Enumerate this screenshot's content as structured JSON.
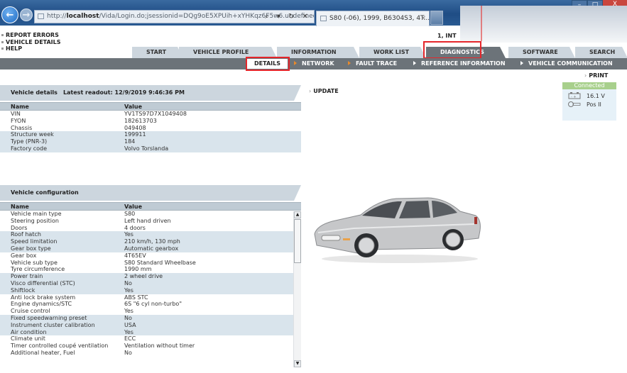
{
  "browser": {
    "url_prefix": "http://",
    "url_host": "localhost",
    "url_path": "/Vida/Login.do;jsessionid=DQg9oE5XPUih+xYHKqz6F5w6.undefined",
    "tools": "⌕ ▾ ↻ ✕",
    "tab_title": "S80 (-06), 1999, B6304S3, 4T...",
    "tab_close": "×",
    "win_min": "–",
    "win_max": "□",
    "win_close": "X"
  },
  "top_links": [
    "REPORT ERRORS",
    "VEHICLE DETAILS",
    "HELP"
  ],
  "session_label": "1, INT",
  "main_tabs": [
    {
      "label": "START",
      "active": false
    },
    {
      "label": "VEHICLE PROFILE",
      "active": false
    },
    {
      "label": "INFORMATION",
      "active": false
    },
    {
      "label": "WORK LIST",
      "active": false
    },
    {
      "label": "DIAGNOSTICS",
      "active": true
    },
    {
      "label": "SOFTWARE",
      "active": false
    },
    {
      "label": "SEARCH",
      "active": false
    }
  ],
  "sub_nav": [
    {
      "label": "DETAILS",
      "active": true
    },
    {
      "label": "NETWORK",
      "arrow": "orange"
    },
    {
      "label": "FAULT TRACE",
      "arrow": "orange"
    },
    {
      "label": "REFERENCE INFORMATION",
      "arrow": "white"
    },
    {
      "label": "VEHICLE COMMUNICATION",
      "arrow": "white"
    }
  ],
  "actions": {
    "update": "UPDATE",
    "print": "PRINT",
    "chevron": "›"
  },
  "status": {
    "connection": "Connected",
    "voltage": "16.1 V",
    "ignition": "Pos II",
    "colors": {
      "connected": "#a8d08c",
      "box": "#e6f1f8"
    }
  },
  "vehicle_details": {
    "title": "Vehicle details",
    "readout": "Latest readout: 12/9/2019 9:46:36 PM",
    "columns": [
      "Name",
      "Value"
    ],
    "rows": [
      [
        "VIN",
        "YV1TS97D7X1049408"
      ],
      [
        "FYON",
        "182613703"
      ],
      [
        "Chassis",
        "049408"
      ],
      [
        "Structure week",
        "199911"
      ],
      [
        "Type (PNR-3)",
        "184"
      ],
      [
        "Factory code",
        "Volvo Torslanda"
      ]
    ]
  },
  "vehicle_configuration": {
    "title": "Vehicle configuration",
    "columns": [
      "Name",
      "Value"
    ],
    "rows": [
      [
        "Vehicle main type",
        "S80"
      ],
      [
        "Steering position",
        "Left hand driven"
      ],
      [
        "Doors",
        "4 doors"
      ],
      [
        "Roof hatch",
        "Yes"
      ],
      [
        "Speed limitation",
        "210 km/h, 130 mph"
      ],
      [
        "Gear box type",
        "Automatic gearbox"
      ],
      [
        "Gear box",
        "4T65EV"
      ],
      [
        "Vehicle sub type",
        "S80 Standard Wheelbase"
      ],
      [
        "Tyre circumference",
        "1990 mm"
      ],
      [
        "Power train",
        "2 wheel drive"
      ],
      [
        "Visco differential (STC)",
        "No"
      ],
      [
        "Shiftlock",
        "Yes"
      ],
      [
        "Anti lock brake system",
        "ABS STC"
      ],
      [
        "Engine dynamics/STC",
        "6S \"6 cyl non-turbo\""
      ],
      [
        "Cruise control",
        "Yes"
      ],
      [
        "Fixed speedwarning preset",
        "No"
      ],
      [
        "Instrument cluster calibration",
        "USA"
      ],
      [
        "Air condition",
        "Yes"
      ],
      [
        "Climate unit",
        "ECC"
      ],
      [
        "Timer controlled coupé ventilation",
        "Ventilation without timer"
      ],
      [
        "Additional heater, Fuel",
        "No"
      ]
    ]
  },
  "scroll": {
    "up": "▲",
    "down": "▼"
  },
  "theme": {
    "nav_dark": "#6c7379",
    "tab_light": "#cdd6de",
    "row_shade": "#d9e4ec",
    "highlight": "#e5262b"
  }
}
